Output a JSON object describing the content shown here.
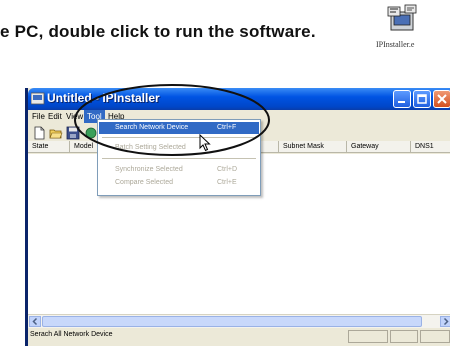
{
  "instruction": "e PC, double click to run the software.",
  "desktop_icon": {
    "label": "IPInstaller.e",
    "icon": "installer-icon"
  },
  "window": {
    "title": "Untitled - IPInstaller",
    "menus": [
      "File",
      "Edit",
      "View",
      "Tool",
      "Help"
    ],
    "active_menu": "Tool",
    "toolbar_icons": [
      "new-file-icon",
      "open-folder-icon",
      "save-icon"
    ],
    "columns": [
      "State",
      "Model",
      "",
      "",
      "",
      "Subnet Mask",
      "Gateway",
      "DNS1"
    ],
    "status_text": "Serach All Network Device"
  },
  "tool_menu": {
    "items": [
      {
        "label": "Search Network Device",
        "shortcut": "Ctrl+F",
        "state": "highlighted"
      },
      {
        "label": "Batch Setting Selected",
        "shortcut": "",
        "state": "disabled"
      },
      {
        "label": "Synchronize Selected",
        "shortcut": "Ctrl+D",
        "state": "disabled"
      },
      {
        "label": "Compare Selected",
        "shortcut": "Ctrl+E",
        "state": "disabled"
      }
    ]
  },
  "colors": {
    "titlebar": "#0054e3",
    "highlight": "#316ac5",
    "window_bg": "#ece9d8"
  }
}
